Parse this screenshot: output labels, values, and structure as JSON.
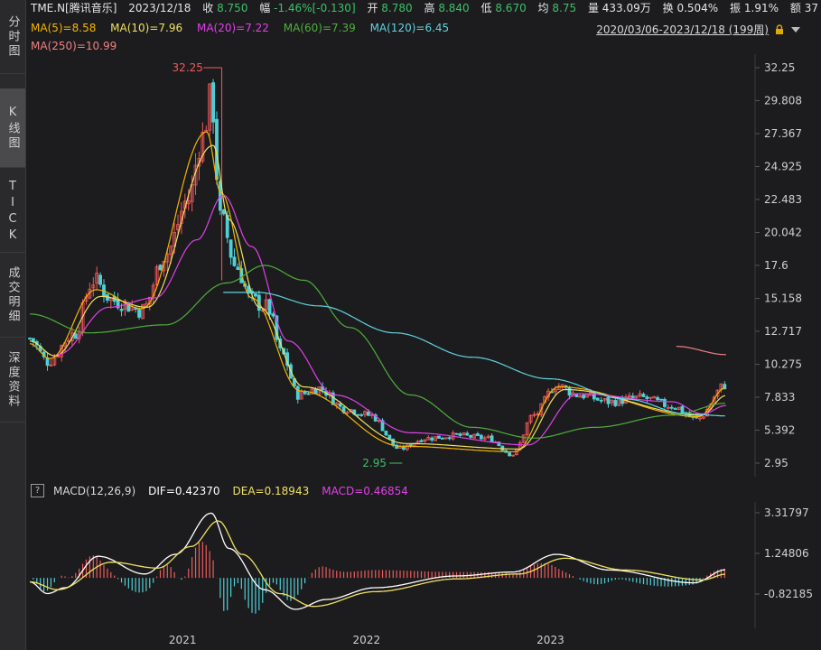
{
  "rail": {
    "tabs": [
      {
        "label": "分时图",
        "active": false
      },
      {
        "label": "K线图",
        "active": true
      },
      {
        "label": "TICK",
        "active": false
      },
      {
        "label": "成交明细",
        "active": false
      },
      {
        "label": "深度资料",
        "active": false
      }
    ]
  },
  "quote": {
    "symbol": "TME.N[腾讯音乐]",
    "date": "2023/12/18",
    "close_label": "收",
    "close": "8.750",
    "change_label": "幅",
    "change": "-1.46%[-0.130]",
    "open_label": "开",
    "open": "8.780",
    "high_label": "高",
    "high": "8.840",
    "low_label": "低",
    "low": "8.670",
    "avg_label": "均",
    "avg": "8.75",
    "volume_label": "量",
    "volume": "433.09万",
    "turnover_label": "换",
    "turnover": "0.504%",
    "amplitude_label": "振",
    "amplitude": "1.91%",
    "amount_label": "额",
    "amount": "37"
  },
  "ma_legend": [
    {
      "text": "MA(5)=8.58",
      "color": "#f5b400"
    },
    {
      "text": "MA(10)=7.96",
      "color": "#f0e060"
    },
    {
      "text": "MA(20)=7.22",
      "color": "#e040e8"
    },
    {
      "text": "MA(60)=7.39",
      "color": "#4fae3c"
    },
    {
      "text": "MA(120)=6.45",
      "color": "#5fd3df"
    }
  ],
  "ma250": {
    "text": "MA(250)=10.99",
    "color": "#f08080"
  },
  "range": {
    "text": "2020/03/06-2023/12/18 (199周)"
  },
  "icons": {
    "lock": "lock-icon",
    "dropdown": "triangle-down-icon",
    "help": "question-icon"
  },
  "macd_legend": {
    "help": "?",
    "name": "MACD(12,26,9)",
    "dif": "DIF=0.42370",
    "dea": "DEA=0.18943",
    "macd": "MACD=0.46854",
    "colors": {
      "dif": "#ffffff",
      "dea": "#f0e060",
      "macd": "#e040e8"
    }
  },
  "annotations": {
    "high": "32.25",
    "low": "2.95"
  },
  "colors": {
    "up": "#f25a5a",
    "down": "#4fd0d8",
    "background": "#1c1c1e"
  },
  "chart_data": {
    "type": "candlestick",
    "period": "weekly",
    "y_ticks": [
      "32.25",
      "29.808",
      "27.367",
      "24.925",
      "22.483",
      "20.042",
      "17.6",
      "15.158",
      "12.717",
      "10.275",
      "7.833",
      "5.392",
      "2.95"
    ],
    "ylim": [
      2.95,
      32.25
    ],
    "x_ticks": [
      "2021",
      "2022",
      "2023"
    ],
    "xrange": [
      "2020/03/06",
      "2023/12/18"
    ],
    "price_anchors": [
      [
        "2020-03-06",
        12.2
      ],
      [
        "2020-04-10",
        10.5
      ],
      [
        "2020-06-01",
        12.5
      ],
      [
        "2020-07-10",
        16.5
      ],
      [
        "2020-08-20",
        15.0
      ],
      [
        "2020-10-15",
        14.3
      ],
      [
        "2020-12-01",
        18.5
      ],
      [
        "2021-01-15",
        22.5
      ],
      [
        "2021-02-10",
        27.0
      ],
      [
        "2021-03-01",
        30.0
      ],
      [
        "2021-03-20",
        21.0
      ],
      [
        "2021-04-20",
        17.5
      ],
      [
        "2021-05-20",
        15.0
      ],
      [
        "2021-06-20",
        14.5
      ],
      [
        "2021-07-20",
        11.0
      ],
      [
        "2021-08-20",
        8.0
      ],
      [
        "2021-10-01",
        8.5
      ],
      [
        "2021-11-20",
        7.0
      ],
      [
        "2022-01-10",
        6.5
      ],
      [
        "2022-03-10",
        4.0
      ],
      [
        "2022-05-01",
        4.8
      ],
      [
        "2022-07-01",
        5.0
      ],
      [
        "2022-09-01",
        4.8
      ],
      [
        "2022-10-20",
        3.6
      ],
      [
        "2022-12-01",
        6.5
      ],
      [
        "2023-01-15",
        8.7
      ],
      [
        "2023-03-01",
        8.0
      ],
      [
        "2023-05-01",
        7.5
      ],
      [
        "2023-07-01",
        7.8
      ],
      [
        "2023-09-01",
        7.2
      ],
      [
        "2023-10-20",
        6.2
      ],
      [
        "2023-12-18",
        8.75
      ]
    ],
    "ma_anchors": {
      "MA(5)": [
        [
          "2020-03-06",
          11.8
        ],
        [
          "2020-04-15",
          10.7
        ],
        [
          "2020-07-15",
          15.8
        ],
        [
          "2020-10-15",
          14.4
        ],
        [
          "2021-02-20",
          27.5
        ],
        [
          "2021-03-20",
          23.0
        ],
        [
          "2021-05-20",
          15.2
        ],
        [
          "2021-08-25",
          8.3
        ],
        [
          "2022-03-15",
          4.2
        ],
        [
          "2022-10-25",
          3.8
        ],
        [
          "2023-01-20",
          8.6
        ],
        [
          "2023-10-25",
          6.4
        ],
        [
          "2023-12-18",
          8.58
        ]
      ],
      "MA(10)": [
        [
          "2020-03-06",
          12.0
        ],
        [
          "2020-04-25",
          10.9
        ],
        [
          "2020-07-25",
          15.3
        ],
        [
          "2020-10-25",
          14.5
        ],
        [
          "2021-03-05",
          26.5
        ],
        [
          "2021-04-05",
          21.0
        ],
        [
          "2021-06-05",
          14.5
        ],
        [
          "2021-09-01",
          8.6
        ],
        [
          "2022-03-25",
          4.4
        ],
        [
          "2022-11-01",
          4.0
        ],
        [
          "2023-02-01",
          8.4
        ],
        [
          "2023-10-30",
          6.5
        ],
        [
          "2023-12-18",
          7.96
        ]
      ],
      "MA(20)": [
        [
          "2020-05-01",
          11.0
        ],
        [
          "2020-08-10",
          14.5
        ],
        [
          "2020-11-10",
          15.2
        ],
        [
          "2021-02-01",
          19.5
        ],
        [
          "2021-03-25",
          22.8
        ],
        [
          "2021-05-20",
          19.0
        ],
        [
          "2021-08-01",
          12.0
        ],
        [
          "2021-11-01",
          8.0
        ],
        [
          "2022-04-01",
          5.2
        ],
        [
          "2022-11-20",
          4.3
        ],
        [
          "2023-03-01",
          8.1
        ],
        [
          "2023-09-01",
          7.5
        ],
        [
          "2023-11-01",
          6.6
        ],
        [
          "2023-12-18",
          7.22
        ]
      ],
      "MA(60)": [
        [
          "2020-03-06",
          14.0
        ],
        [
          "2020-07-01",
          12.6
        ],
        [
          "2020-12-01",
          13.2
        ],
        [
          "2021-04-01",
          16.3
        ],
        [
          "2021-06-15",
          17.6
        ],
        [
          "2021-09-01",
          16.5
        ],
        [
          "2021-12-01",
          13.0
        ],
        [
          "2022-04-01",
          8.0
        ],
        [
          "2022-08-01",
          5.6
        ],
        [
          "2022-12-01",
          4.8
        ],
        [
          "2023-04-01",
          5.6
        ],
        [
          "2023-09-01",
          6.5
        ],
        [
          "2023-12-18",
          7.39
        ]
      ],
      "MA(120)": [
        [
          "2021-03-25",
          15.6
        ],
        [
          "2021-06-01",
          15.6
        ],
        [
          "2021-10-01",
          14.6
        ],
        [
          "2022-03-01",
          12.6
        ],
        [
          "2022-08-01",
          10.8
        ],
        [
          "2023-01-01",
          9.2
        ],
        [
          "2023-06-01",
          7.7
        ],
        [
          "2023-10-01",
          6.6
        ],
        [
          "2023-12-18",
          6.45
        ]
      ],
      "MA(250)": [
        [
          "2023-09-10",
          11.6
        ],
        [
          "2023-12-18",
          10.99
        ]
      ]
    },
    "macd": {
      "y_ticks": [
        "3.31797",
        "1.24806",
        "-0.82185"
      ],
      "ylim": [
        -2.2,
        3.5
      ],
      "dif_anchors": [
        [
          "2020-03-06",
          -0.2
        ],
        [
          "2020-04-10",
          -0.8
        ],
        [
          "2020-05-15",
          -0.5
        ],
        [
          "2020-07-20",
          1.1
        ],
        [
          "2020-10-20",
          0.2
        ],
        [
          "2020-12-20",
          1.2
        ],
        [
          "2021-03-01",
          3.3
        ],
        [
          "2021-04-05",
          1.5
        ],
        [
          "2021-06-15",
          -0.6
        ],
        [
          "2021-08-15",
          -1.6
        ],
        [
          "2021-10-15",
          -1.1
        ],
        [
          "2022-01-20",
          -0.5
        ],
        [
          "2022-07-01",
          0.1
        ],
        [
          "2022-10-20",
          0.3
        ],
        [
          "2023-01-15",
          1.2
        ],
        [
          "2023-05-01",
          0.4
        ],
        [
          "2023-10-15",
          -0.25
        ],
        [
          "2023-12-18",
          0.42
        ]
      ],
      "dea_anchors": [
        [
          "2020-03-06",
          -0.2
        ],
        [
          "2020-05-01",
          -0.6
        ],
        [
          "2020-08-15",
          0.8
        ],
        [
          "2020-11-15",
          0.5
        ],
        [
          "2021-01-20",
          1.6
        ],
        [
          "2021-03-15",
          2.9
        ],
        [
          "2021-05-01",
          1.2
        ],
        [
          "2021-07-15",
          -0.8
        ],
        [
          "2021-09-20",
          -1.45
        ],
        [
          "2022-01-20",
          -0.7
        ],
        [
          "2022-07-01",
          -0.05
        ],
        [
          "2022-11-01",
          0.2
        ],
        [
          "2023-02-01",
          1.0
        ],
        [
          "2023-06-01",
          0.4
        ],
        [
          "2023-11-01",
          -0.1
        ],
        [
          "2023-12-18",
          0.19
        ]
      ]
    }
  }
}
